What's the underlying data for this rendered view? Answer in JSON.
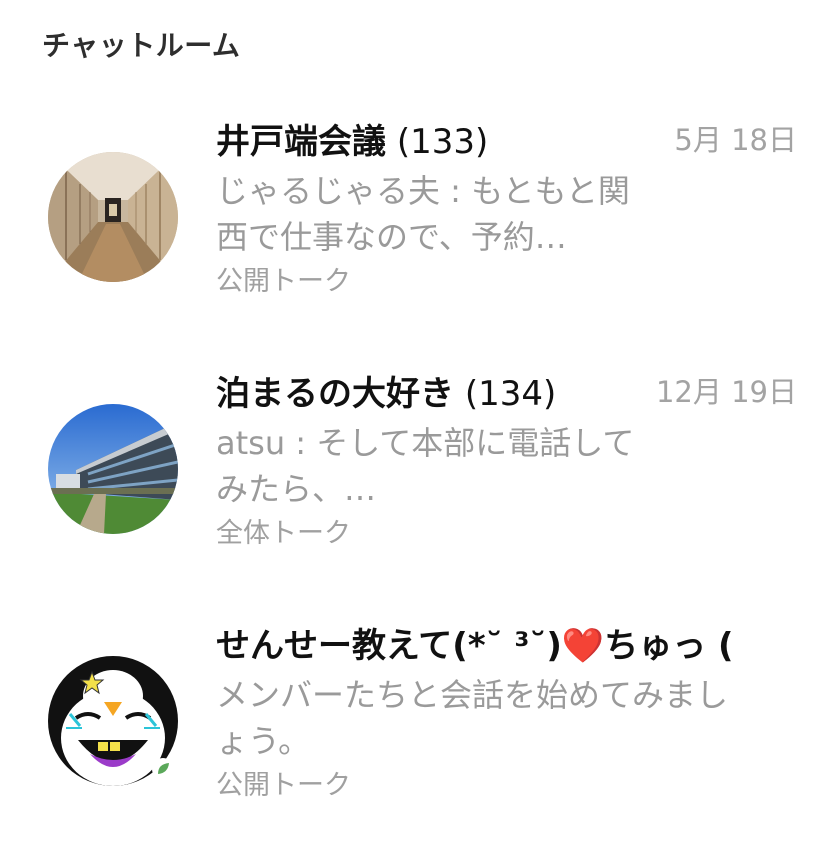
{
  "header": {
    "title": "チャットルーム"
  },
  "chats": [
    {
      "name": "井戸端会議",
      "count": "(133)",
      "date": "5月 18日",
      "preview": "じゃるじゃる夫 : もともと関西で仕事なので、予約…",
      "type": "公開トーク",
      "avatar_icon": "corridor-photo-icon"
    },
    {
      "name": "泊まるの大好き",
      "count": "(134)",
      "date": "12月 19日",
      "preview": "atsu : そして本部に電話してみたら、…",
      "type": "全体トーク",
      "avatar_icon": "building-photo-icon"
    },
    {
      "name": "せんせー教えて(*˘ ³˘)❤️ちゅっ (",
      "count": "",
      "date": "",
      "preview": "メンバーたちと会話を始めてみましょう。",
      "type": "公開トーク",
      "avatar_icon": "penguin-cartoon-icon"
    }
  ],
  "colors": {
    "title": "#2e2e2e",
    "name": "#111111",
    "secondary": "#9a9a9a",
    "date": "#a3a3a3",
    "background": "#ffffff"
  }
}
